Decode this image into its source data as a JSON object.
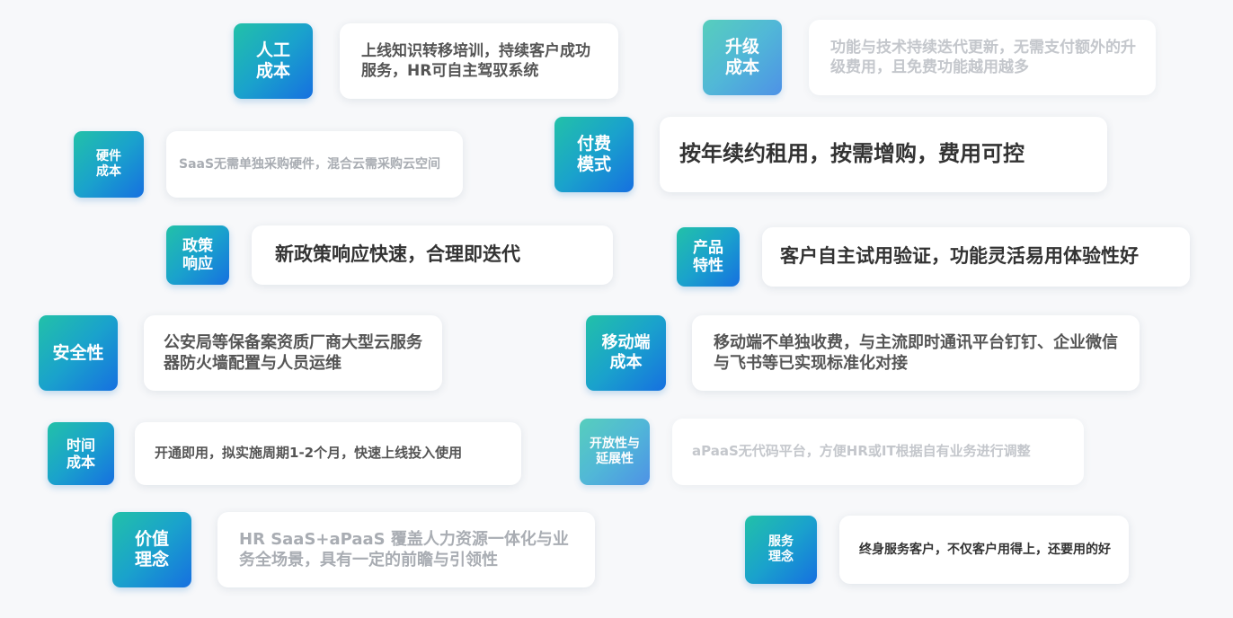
{
  "items": [
    {
      "badge": "人工\n成本",
      "text": "上线知识转移培训，持续客户成功服务，HR可自主驾驭系统"
    },
    {
      "badge": "升级\n成本",
      "text": "功能与技术持续迭代更新，无需支付额外的升级费用，且免费功能越用越多"
    },
    {
      "badge": "硬件\n成本",
      "text": "SaaS无需单独采购硬件，混合云需采购云空间"
    },
    {
      "badge": "付费\n模式",
      "text": "按年续约租用，按需增购，费用可控"
    },
    {
      "badge": "政策\n响应",
      "text": "新政策响应快速，合理即迭代"
    },
    {
      "badge": "产品\n特性",
      "text": "客户自主试用验证，功能灵活易用体验性好"
    },
    {
      "badge": "安全性",
      "text": "公安局等保备案资质厂商大型云服务器防火墙配置与人员运维"
    },
    {
      "badge": "移动端\n成本",
      "text": "移动端不单独收费，与主流即时通讯平台钉钉、企业微信与飞书等已实现标准化对接"
    },
    {
      "badge": "时间\n成本",
      "text": "开通即用，拟实施周期1-2个月，快速上线投入使用"
    },
    {
      "badge": "开放性与\n延展性",
      "text": "aPaaS无代码平台，方便HR或IT根据自有业务进行调整"
    },
    {
      "badge": "价值\n理念",
      "text": "HR SaaS+aPaaS 覆盖人力资源一体化与业务全场景，具有一定的前瞻与引领性"
    },
    {
      "badge": "服务\n理念",
      "text": "终身服务客户，不仅客户用得上，还要用的好"
    }
  ]
}
